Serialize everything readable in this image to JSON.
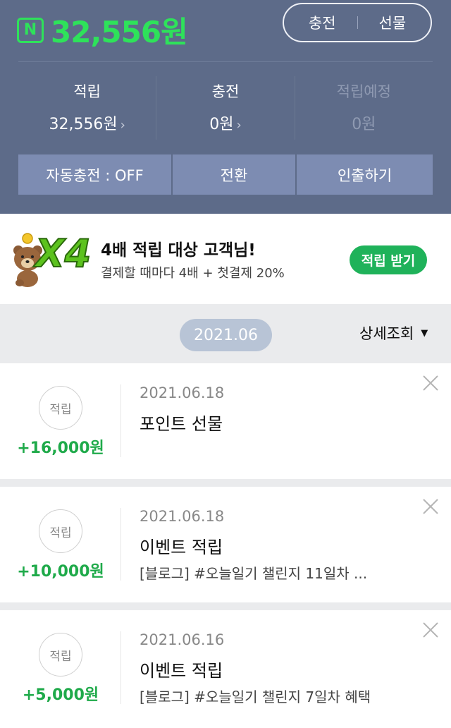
{
  "header": {
    "balance_icon": "N",
    "balance": "32,556원",
    "charge_button": "충전",
    "gift_button": "선물",
    "stats": [
      {
        "label": "적립",
        "value": "32,556원",
        "chevron": "›"
      },
      {
        "label": "충전",
        "value": "0원",
        "chevron": "›"
      },
      {
        "label": "적립예정",
        "value": "0원",
        "chevron": ""
      }
    ],
    "actions": [
      "자동충전 : OFF",
      "전환",
      "인출하기"
    ]
  },
  "banner": {
    "title": "4배 적립 대상 고객님!",
    "subtitle": "결제할 때마다 4배 + 첫결제 20%",
    "badge": "X4",
    "button": "적립 받기"
  },
  "filter": {
    "month": "2021.06",
    "detail_label": "상세조회",
    "detail_caret": "▼"
  },
  "entries": [
    {
      "type": "적립",
      "amount": "+16,000원",
      "date": "2021.06.18",
      "title": "포인트 선물",
      "desc": ""
    },
    {
      "type": "적립",
      "amount": "+10,000원",
      "date": "2021.06.18",
      "title": "이벤트 적립",
      "desc": "[블로그] #오늘일기 챌린지 11일차 ..."
    },
    {
      "type": "적립",
      "amount": "+5,000원",
      "date": "2021.06.16",
      "title": "이벤트 적립",
      "desc": "[블로그] #오늘일기 챌린지 7일차 혜택"
    }
  ],
  "colors": {
    "header_bg": "#5d6b89",
    "accent_green": "#2ee25a",
    "amount_green": "#1faa4a",
    "button_green": "#1fb25a",
    "action_btn": "#7d8cb2",
    "month_pill": "#b8c4d6"
  },
  "icons": {
    "balance": "naver-pay-n-icon",
    "bear": "brown-bear-character-icon",
    "close": "close-icon",
    "chevron": "chevron-right-icon",
    "caret": "caret-down-icon"
  }
}
